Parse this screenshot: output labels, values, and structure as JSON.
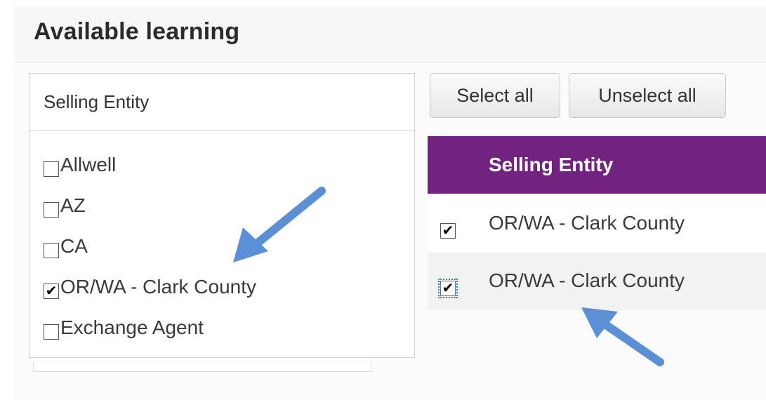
{
  "panel": {
    "title": "Available learning"
  },
  "filter": {
    "header": "Selling Entity",
    "items": [
      {
        "label": "Allwell",
        "checked": false
      },
      {
        "label": "AZ",
        "checked": false
      },
      {
        "label": "CA",
        "checked": false
      },
      {
        "label": "OR/WA - Clark County",
        "checked": true
      },
      {
        "label": "Exchange Agent",
        "checked": false
      }
    ]
  },
  "toolbar": {
    "select_all": "Select all",
    "unselect_all": "Unselect all"
  },
  "grid": {
    "header": "Selling Entity",
    "rows": [
      {
        "label": "OR/WA - Clark County",
        "checked": true
      },
      {
        "label": "OR/WA - Clark County",
        "checked": true
      }
    ]
  },
  "colors": {
    "header_bg": "#72237f",
    "arrow": "#5b8fd6"
  },
  "icons": {
    "check": "checkmark-icon",
    "arrow": "annotation-arrow-icon"
  }
}
